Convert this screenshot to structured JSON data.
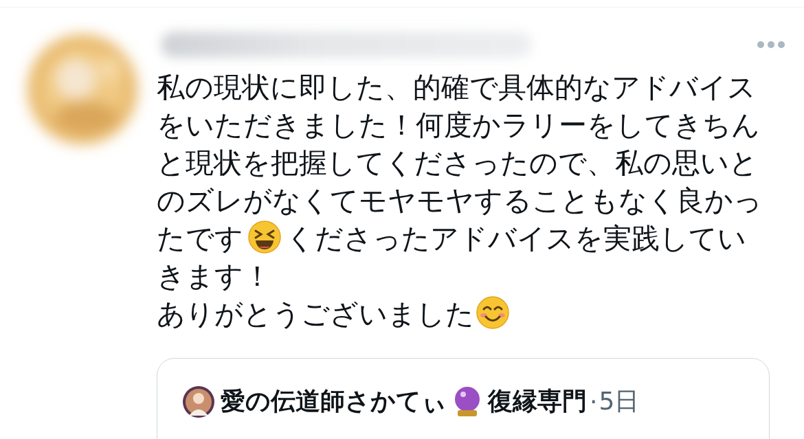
{
  "reply": {
    "lines": [
      [
        {
          "kind": "text",
          "text": "私の現状に即した、的確で具体的なアドバイス"
        }
      ],
      [
        {
          "kind": "text",
          "text": "をいただきました！何度かラリーをしてきちん"
        }
      ],
      [
        {
          "kind": "text",
          "text": "と現状を把握してくださったので、私の思いと"
        }
      ],
      [
        {
          "kind": "text",
          "text": "のズレがなくてモヤモヤすることもなく良かっ"
        }
      ],
      [
        {
          "kind": "text",
          "text": "たです"
        },
        {
          "kind": "laughing"
        },
        {
          "kind": "text",
          "text": "くださったアドバイスを実践してい"
        }
      ],
      [
        {
          "kind": "text",
          "text": "きます！"
        }
      ],
      [
        {
          "kind": "text",
          "text": "ありがとうございました"
        },
        {
          "kind": "smiling"
        }
      ]
    ],
    "quoted": {
      "name_start": "愛の伝道師さかてぃ",
      "name_end": "復縁専門",
      "separator": "·",
      "time": "5日"
    }
  }
}
